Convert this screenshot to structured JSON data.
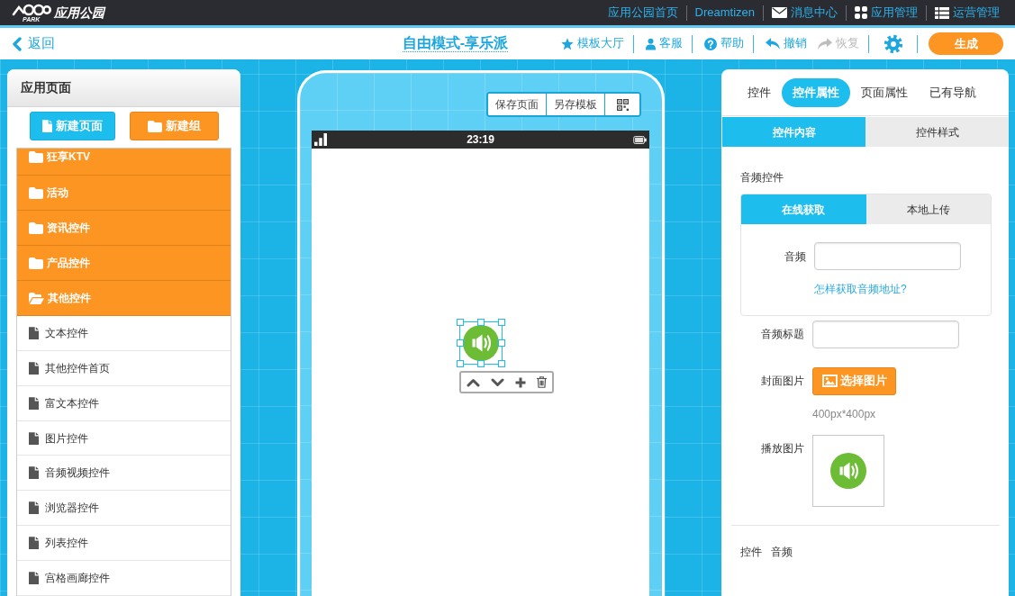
{
  "top_bar": {
    "logo": {
      "text": "应用公园",
      "subtext": "PARK"
    },
    "links": [
      {
        "label": "应用公园首页",
        "kind": "plain"
      },
      {
        "label": "Dreamtizen",
        "kind": "plain"
      },
      {
        "label": "消息中心",
        "kind": "messages"
      },
      {
        "label": "应用管理",
        "kind": "apps"
      },
      {
        "label": "运营管理",
        "kind": "operations"
      }
    ]
  },
  "toolbar": {
    "back": "返回",
    "title": "自由模式-享乐派",
    "actions": [
      {
        "label": "模板大厅",
        "kind": "templates",
        "disabled": false
      },
      {
        "label": "客服",
        "kind": "support",
        "disabled": false
      },
      {
        "label": "帮助",
        "kind": "help",
        "disabled": false
      },
      {
        "label": "撤销",
        "kind": "undo",
        "disabled": false
      },
      {
        "label": "恢复",
        "kind": "redo",
        "disabled": true
      }
    ],
    "generate": "生成"
  },
  "sidebar": {
    "title": "应用页面",
    "buttons": [
      {
        "label": "新建页面",
        "kind": "page"
      },
      {
        "label": "新建组",
        "kind": "group"
      }
    ],
    "items": [
      {
        "label": "狂享KTV",
        "expanded": false
      },
      {
        "label": "活动",
        "expanded": false
      },
      {
        "label": "资讯控件",
        "expanded": false
      },
      {
        "label": "产品控件",
        "expanded": false
      },
      {
        "label": "其他控件",
        "expanded": true,
        "children": [
          {
            "label": "文本控件"
          },
          {
            "label": "其他控件首页"
          },
          {
            "label": "富文本控件"
          },
          {
            "label": "图片控件"
          },
          {
            "label": "音频视频控件"
          },
          {
            "label": "浏览器控件"
          },
          {
            "label": "列表控件"
          },
          {
            "label": "宫格画廊控件"
          }
        ]
      }
    ]
  },
  "phone": {
    "buttons": [
      "保存页面",
      "另存模板"
    ],
    "status_bar": {
      "time": "23:19"
    },
    "widgets": [
      {
        "kind": "audio",
        "selected": true
      }
    ]
  },
  "properties": {
    "tabs": [
      {
        "label": "控件",
        "selected": false
      },
      {
        "label": "控件属性",
        "selected": true
      },
      {
        "label": "页面属性",
        "selected": false
      },
      {
        "label": "已有导航",
        "selected": false
      }
    ],
    "sub_tabs": [
      {
        "label": "控件内容",
        "selected": true
      },
      {
        "label": "控件样式",
        "selected": false
      }
    ],
    "section_title": "音频控件",
    "source_tabs": [
      {
        "label": "在线获取",
        "selected": true
      },
      {
        "label": "本地上传",
        "selected": false
      }
    ],
    "audio_field": {
      "label": "音频"
    },
    "help_link": "怎样获取音频地址?",
    "title_field": {
      "label": "音频标题"
    },
    "cover": {
      "label": "封面图片",
      "button": "选择图片",
      "hint": "400px*400px"
    },
    "play_image": {
      "label": "播放图片"
    },
    "footer": {
      "label": "控件",
      "value": "音频"
    }
  }
}
